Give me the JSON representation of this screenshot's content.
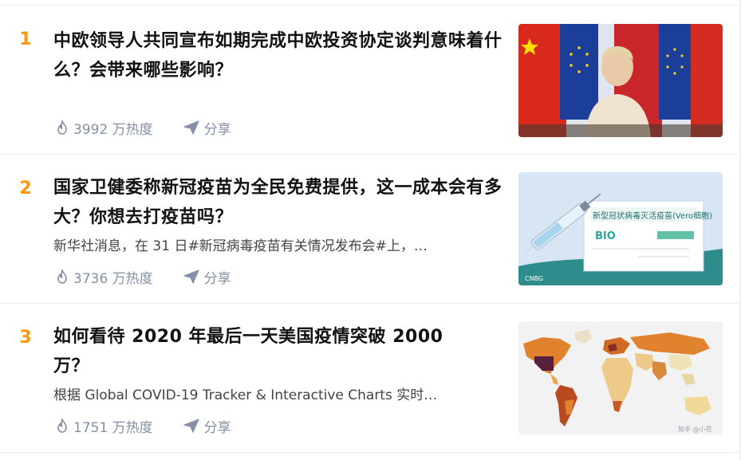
{
  "items": [
    {
      "rank": "1",
      "title": "中欧领导人共同宣布如期完成中欧投资协定谈判意味着什么？会带来哪些影响？",
      "excerpt": "",
      "heat": "3992 万热度",
      "share": "分享",
      "image_icon": "photo-eu-china-flags"
    },
    {
      "rank": "2",
      "title": "国家卫健委称新冠疫苗为全民免费提供，这一成本会有多大？你想去打疫苗吗？",
      "excerpt": "新华社消息，在 31 日#新冠病毒疫苗有关情况发布会#上，…",
      "heat": "3736 万热度",
      "share": "分享",
      "image_icon": "photo-vaccine-vial",
      "image_text": {
        "box_label": "新型冠状病毒灭活疫苗(Vero细胞)",
        "brand": "BIO",
        "corner": "CNBG"
      }
    },
    {
      "rank": "3",
      "title": "如何看待 2020 年最后一天美国疫情突破 2000 万？",
      "excerpt": "根据 Global COVID-19 Tracker & Interactive Charts 实时…",
      "heat": "1751 万热度",
      "share": "分享",
      "image_icon": "photo-world-map",
      "image_text": {
        "watermark": "知乎 @小花"
      }
    }
  ],
  "colors": {
    "rank": "#ff9607",
    "title": "#121212",
    "meta": "#8590a6",
    "divider": "#ececec"
  }
}
